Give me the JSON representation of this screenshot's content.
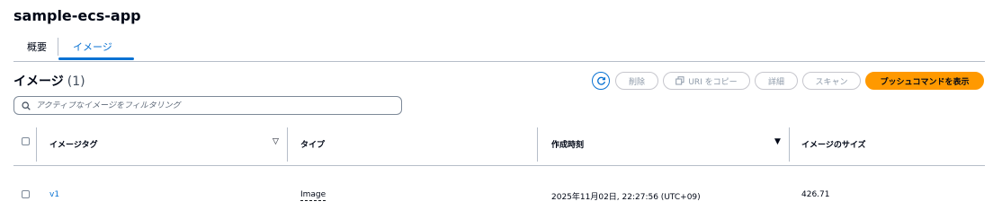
{
  "page": {
    "title": "sample-ecs-app"
  },
  "tabs": [
    {
      "label": "概要"
    },
    {
      "label": "イメージ"
    }
  ],
  "section": {
    "title": "イメージ",
    "count": "(1)"
  },
  "toolbar": {
    "delete_label": "削除",
    "copy_uri_label": "URI をコピー",
    "details_label": "詳細",
    "scan_label": "スキャン",
    "push_label": "プッシュコマンドを表示"
  },
  "search": {
    "placeholder": "アクティブなイメージをフィルタリング",
    "value": ""
  },
  "table": {
    "columns": [
      "イメージタグ",
      "タイプ",
      "作成時刻",
      "イメージのサイズ"
    ],
    "rows": [
      {
        "tag": "v1",
        "type": "Image",
        "created": "2025年11月02日, 22:27:56 (UTC+09)",
        "size": "426.71"
      }
    ]
  },
  "colors": {
    "accent": "#0972d3",
    "primary_button": "#ff9900"
  }
}
